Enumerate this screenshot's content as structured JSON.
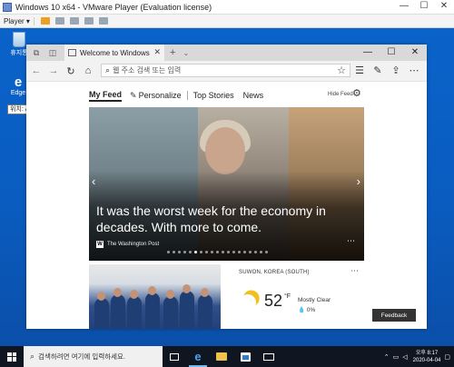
{
  "vmware": {
    "title": "Windows 10 x64 - VMware Player (Evaluation license)",
    "player_menu": "Player ▾",
    "controls": {
      "minimize": "—",
      "maximize": "☐",
      "close": "✕"
    }
  },
  "desktop": {
    "recycle_bin_label": "휴지통",
    "edge_label": "Edge",
    "tooltip": "위치: Applications"
  },
  "edge": {
    "tab_title": "Welcome to Windows",
    "new_tab": "+",
    "tab_dropdown": "⌄",
    "window_controls": {
      "minimize": "—",
      "maximize": "☐",
      "close": "✕"
    },
    "address_placeholder": "웹 주소 검색 또는 입력",
    "colors": {
      "tabbar": "#d9d9d9",
      "toolbar": "#f2f2f2"
    }
  },
  "feed": {
    "tabs": {
      "my_feed": "My Feed",
      "personalize": "Personalize",
      "top_stories": "Top Stories",
      "news": "News"
    },
    "hide_feed": "Hide Feed",
    "hero": {
      "headline": "It was the worst week for the economy in decades. With more to come.",
      "source": "The Washington Post",
      "source_icon": "wp",
      "dots": 19,
      "active_dot": 5
    },
    "weather": {
      "location": "SUWON, KOREA (SOUTH)",
      "temp": "52",
      "unit": "°F",
      "condition": "Mostly Clear",
      "precip": "0%"
    },
    "feedback": "Feedback"
  },
  "taskbar": {
    "search_placeholder": "검색하려면 여기에 입력하세요.",
    "clock_time": "오후 8:17",
    "clock_date": "2020-04-04",
    "accent": "#76b9ed"
  }
}
